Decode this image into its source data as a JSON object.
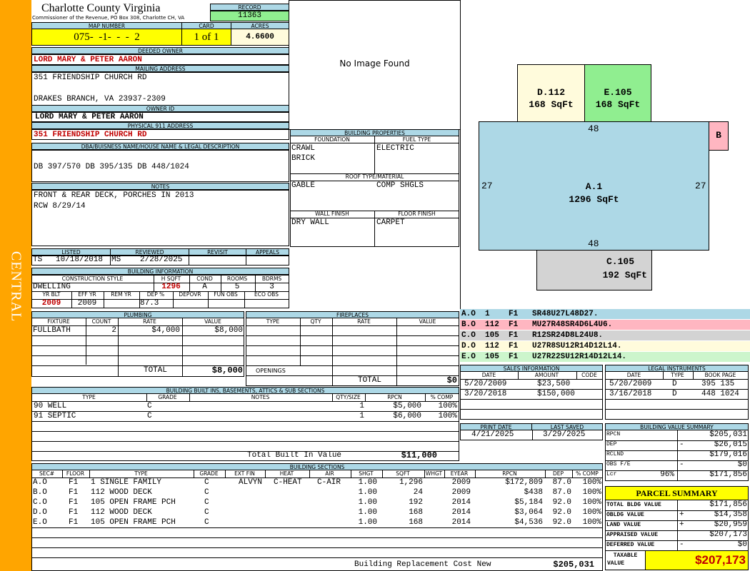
{
  "side_label": "CENTRAL",
  "county": {
    "name": "Charlotte County Virginia",
    "subtitle": "Commissioner of the Revenue, PO Box 308, Charlotte CH, VA"
  },
  "record": {
    "label": "RECORD",
    "value": "11363"
  },
  "map_number": {
    "label": "MAP NUMBER",
    "value": "075-  -1-  -  -  2"
  },
  "card": {
    "label": "CARD",
    "value": "1 of 1"
  },
  "acres": {
    "label": "ACRES",
    "value": "4.6600"
  },
  "deeded_owner": {
    "label": "DEEDED OWNER",
    "value": "LORD MARY & PETER AARON"
  },
  "mailing_address": {
    "label": "MAILING ADDRESS",
    "line1": "351 FRIENDSHIP CHURCH RD",
    "line2": "DRAKES BRANCH, VA 23937-2309"
  },
  "owner_id": {
    "label": "OWNER ID",
    "value": "LORD MARY & PETER AARON"
  },
  "physical_address": {
    "label": "PHYSICAL 911 ADDRESS",
    "value": "351 FRIENDSHIP CHURCH RD"
  },
  "dba": {
    "label": "DBA/BUISNESS NAME/HOUSE NAME & LEGAL DESCRIPTION",
    "value": "DB 397/570 DB 395/135 DB 448/1024"
  },
  "notes": {
    "label": "NOTES",
    "line1": "FRONT & REAR DECK, PORCHES IN 2013",
    "line2": "RCW 8/29/14"
  },
  "listing": {
    "listed_label": "LISTED",
    "reviewed_label": "REVIEWED",
    "revisit_label": "REVISIT",
    "appeals_label": "APPEALS",
    "listed_by": "TS",
    "listed_date": "10/18/2018",
    "reviewed_by": "MS",
    "reviewed_date": "2/28/2025"
  },
  "building_info": {
    "label": "BUILDING INFORMATION",
    "h": {
      "style": "CONSTRUCTION STYLE",
      "hsqft": "H SQFT",
      "cond": "COND",
      "rooms": "ROOMS",
      "bdrms": "BDRMS",
      "yrblt": "YR BLT",
      "effyr": "EFF YR",
      "remyr": "REM YR",
      "dep": "DEP %",
      "depovr": "DEPOVR",
      "funobs": "FUN OBS",
      "ecoobs": "ECO OBS"
    },
    "style": "DWELLING",
    "hsqft": "1296",
    "cond": "A",
    "rooms": "5",
    "bdrms": "3",
    "yrblt": "2009",
    "effyr": "2009",
    "remyr": "",
    "dep": "87.3",
    "depovr": "",
    "funobs": "",
    "ecoobs": ""
  },
  "image": {
    "text": "No Image Found"
  },
  "building_properties": {
    "label": "BUILDING PROPERTIES",
    "foundation_label": "FOUNDATION",
    "fuel_label": "FUEL TYPE",
    "foundation1": "CRAWL",
    "foundation2": "BRICK",
    "fuel": "ELECTRIC",
    "roof_label": "ROOF TYPE/MATERIAL",
    "roof_type": "GABLE",
    "roof_material": "COMP SHGLS",
    "wall_label": "WALL FINISH",
    "floor_label": "FLOOR FINISH",
    "wall": "DRY WALL",
    "floor": "CARPET"
  },
  "sketch": {
    "areas": [
      {
        "id": "A.1",
        "sqft": "1296 SqFt",
        "color": "#add8e6"
      },
      {
        "id": "D.112",
        "sqft": "168 SqFt",
        "color": "#fffbdc"
      },
      {
        "id": "E.105",
        "sqft": "168 SqFt",
        "color": "#90ee90"
      },
      {
        "id": "C.105",
        "sqft": "192 SqFt",
        "color": "#d3d3d3"
      },
      {
        "id": "B",
        "sqft": "",
        "color": "#ffb6c1"
      }
    ],
    "dims": {
      "top": "48",
      "bottom": "48",
      "left": "27",
      "right": "27"
    }
  },
  "sketch_codes": [
    {
      "text": "A.O  1    F1   SR48U27L48D27.",
      "color": "#add8e6"
    },
    {
      "text": "B.O  112  F1   MU27R48SR4D6L4U6.",
      "color": "#ffb6c1"
    },
    {
      "text": "C.O  105  F1   R12SR24D8L24U8.",
      "color": "#d3d3d3"
    },
    {
      "text": "D.O  112  F1   U27R8SU12R14D12L14.",
      "color": "#fffbdc"
    },
    {
      "text": "E.O  105  F1   U27R22SU12R14D12L14.",
      "color": "#ccf5cc"
    }
  ],
  "plumbing": {
    "label": "PLUMBING",
    "h": [
      "FIXTURE",
      "COUNT",
      "RATE",
      "VALUE"
    ],
    "rows": [
      {
        "fixture": "FULLBATH",
        "count": "2",
        "rate": "$4,000",
        "value": "$8,000"
      }
    ],
    "total_label": "TOTAL",
    "total": "$8,000"
  },
  "fireplaces": {
    "label": "FIREPLACES",
    "h": [
      "TYPE",
      "QTY",
      "RATE",
      "VALUE"
    ],
    "openings_label": "OPENINGS",
    "total_label": "TOTAL",
    "total": "$0"
  },
  "built_ins": {
    "label": "BUILDING BUILT INS, BASEMENTS, ATTICS & SUB SECTIONS",
    "h": [
      "TYPE",
      "GRADE",
      "NOTES",
      "QTY/SIZE",
      "RPCN",
      "% COMP"
    ],
    "rows": [
      {
        "type": "90 WELL",
        "grade": "C",
        "qty": "1",
        "rpcn": "$5,000",
        "comp": "100%"
      },
      {
        "type": "91 SEPTIC",
        "grade": "C",
        "qty": "1",
        "rpcn": "$6,000",
        "comp": "100%"
      }
    ],
    "total_label": "Total Built In Value",
    "total": "$11,000"
  },
  "sales": {
    "label": "SALES INFORMATION",
    "h": [
      "DATE",
      "AMOUNT",
      "CODE"
    ],
    "rows": [
      {
        "date": "5/20/2009",
        "amount": "$23,500",
        "code": ""
      },
      {
        "date": "3/20/2018",
        "amount": "$150,000",
        "code": ""
      }
    ]
  },
  "legal": {
    "label": "LEGAL INSTRUMENTS",
    "h": [
      "DATE",
      "TYPE",
      "BOOK PAGE"
    ],
    "rows": [
      {
        "date": "5/20/2009",
        "type": "D",
        "book": "395 135"
      },
      {
        "date": "3/16/2018",
        "type": "D",
        "book": "448 1024"
      }
    ]
  },
  "print_info": {
    "print_label": "PRINT DATE",
    "saved_label": "LAST SAVED",
    "print_date": "4/21/2025",
    "last_saved": "3/29/2025"
  },
  "bvs": {
    "label": "BUILDING VALUE SUMMARY",
    "rows": [
      {
        "label": "RPCN",
        "sign": "",
        "pct": "",
        "value": "$205,031"
      },
      {
        "label": "DEP",
        "sign": "-",
        "pct": "",
        "value": "$26,015"
      },
      {
        "label": "RCLND",
        "sign": "",
        "pct": "",
        "value": "$179,016"
      },
      {
        "label": "OBS F/E",
        "sign": "-",
        "pct": "",
        "value": "$0"
      },
      {
        "label": "Lcr",
        "sign": "",
        "pct": "96%",
        "value": "$171,856"
      }
    ]
  },
  "parcel": {
    "label": "PARCEL SUMMARY",
    "rows": [
      {
        "label": "TOTAL BLDG VALUE",
        "sign": "",
        "value": "$171,856"
      },
      {
        "label": "OBLDG VALUE",
        "sign": "+",
        "value": "$14,358"
      },
      {
        "label": "LAND VALUE",
        "sign": "+",
        "value": "$20,959"
      },
      {
        "label": "APPRAISED VALUE",
        "sign": "",
        "value": "$207,173"
      },
      {
        "label": "DEFERRED VALUE",
        "sign": "-",
        "value": "$0"
      }
    ],
    "taxable_label1": "TAXABLE",
    "taxable_label2": "VALUE",
    "taxable": "$207,173"
  },
  "sections": {
    "label": "BUILDING SECTIONS",
    "h": [
      "SEC#",
      "FLOOR",
      "TYPE",
      "GRADE",
      "EXT FIN",
      "HEAT",
      "AIR",
      "SHGT",
      "SQFT",
      "WHGT",
      "EYEAR",
      "RPCN",
      "DEP",
      "% COMP"
    ],
    "rows": [
      {
        "sec": "A.O",
        "floor": "F1",
        "type": "1 SINGLE FAMILY",
        "grade": "C",
        "ext": "ALVYN",
        "heat": "C-HEAT",
        "air": "C-AIR",
        "shgt": "1.00",
        "sqft": "1,296",
        "whgt": "",
        "eyear": "2009",
        "rpcn": "$172,809",
        "dep": "87.0",
        "comp": "100%"
      },
      {
        "sec": "B.O",
        "floor": "F1",
        "type": "112 WOOD DECK",
        "grade": "C",
        "ext": "",
        "heat": "",
        "air": "",
        "shgt": "1.00",
        "sqft": "24",
        "whgt": "",
        "eyear": "2009",
        "rpcn": "$438",
        "dep": "87.0",
        "comp": "100%"
      },
      {
        "sec": "C.O",
        "floor": "F1",
        "type": "105 OPEN FRAME PCH",
        "grade": "C",
        "ext": "",
        "heat": "",
        "air": "",
        "shgt": "1.00",
        "sqft": "192",
        "whgt": "",
        "eyear": "2014",
        "rpcn": "$5,184",
        "dep": "92.0",
        "comp": "100%"
      },
      {
        "sec": "D.O",
        "floor": "F1",
        "type": "112 WOOD DECK",
        "grade": "C",
        "ext": "",
        "heat": "",
        "air": "",
        "shgt": "1.00",
        "sqft": "168",
        "whgt": "",
        "eyear": "2014",
        "rpcn": "$3,064",
        "dep": "92.0",
        "comp": "100%"
      },
      {
        "sec": "E.O",
        "floor": "F1",
        "type": "105 OPEN FRAME PCH",
        "grade": "C",
        "ext": "",
        "heat": "",
        "air": "",
        "shgt": "1.00",
        "sqft": "168",
        "whgt": "",
        "eyear": "2014",
        "rpcn": "$4,536",
        "dep": "92.0",
        "comp": "100%"
      }
    ],
    "total_label": "Building Replacement Cost New",
    "total": "$205,031"
  }
}
